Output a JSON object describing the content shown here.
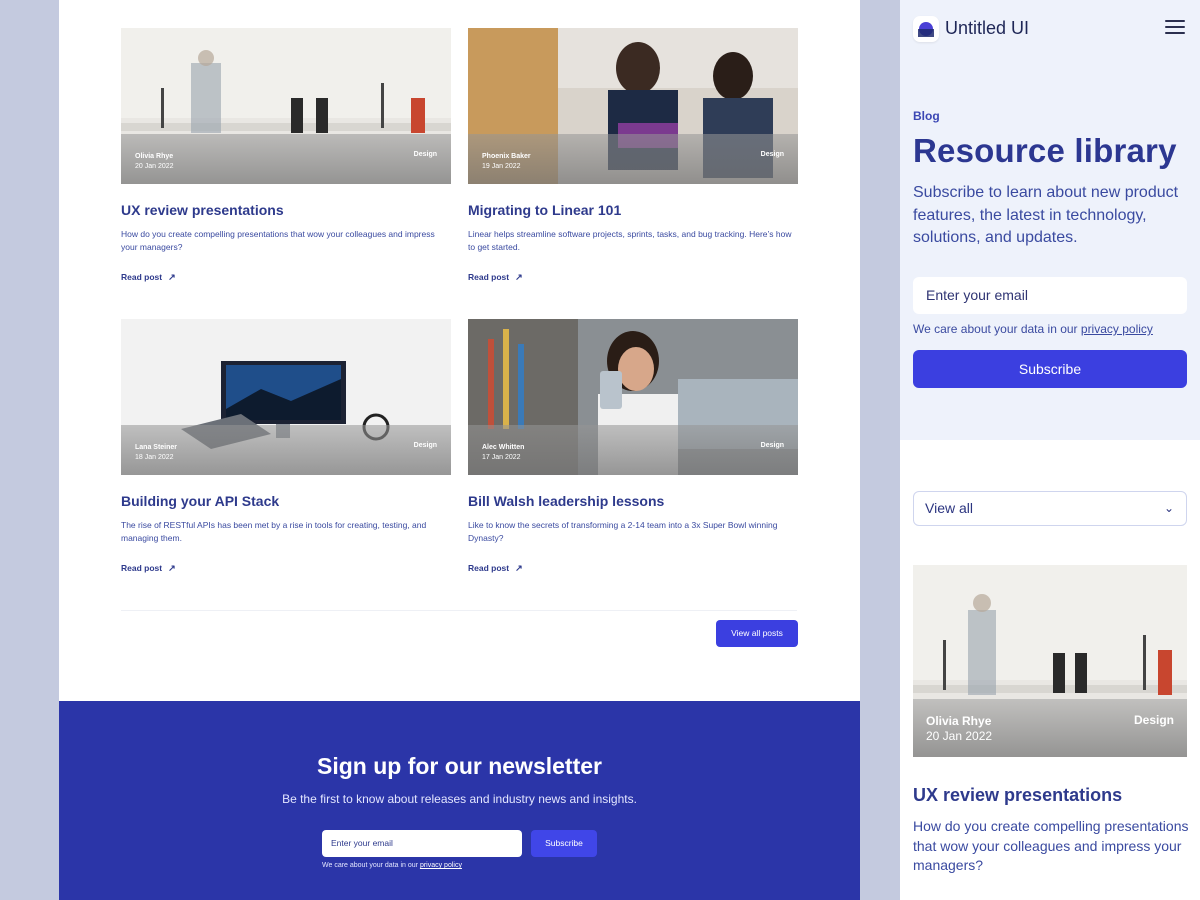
{
  "posts": [
    {
      "author": "Olivia Rhye",
      "date": "20 Jan 2022",
      "category": "Design",
      "title": "UX review presentations",
      "excerpt": "How do you create compelling presentations that wow your colleagues and impress your managers?",
      "read_label": "Read post",
      "arrow": "↗"
    },
    {
      "author": "Phoenix Baker",
      "date": "19 Jan 2022",
      "category": "Design",
      "title": "Migrating to Linear 101",
      "excerpt": "Linear helps streamline software projects, sprints, tasks, and bug tracking. Here’s how to get started.",
      "read_label": "Read post",
      "arrow": "↗"
    },
    {
      "author": "Lana Steiner",
      "date": "18 Jan 2022",
      "category": "Design",
      "title": "Building your API Stack",
      "excerpt": "The rise of RESTful APIs has been met by a rise in tools for creating, testing, and managing them.",
      "read_label": "Read post",
      "arrow": "↗"
    },
    {
      "author": "Alec Whitten",
      "date": "17 Jan 2022",
      "category": "Design",
      "title": "Bill Walsh leadership lessons",
      "excerpt": "Like to know the secrets of transforming a 2-14 team into a 3x Super Bowl winning Dynasty?",
      "read_label": "Read post",
      "arrow": "↗"
    }
  ],
  "view_all_posts_label": "View all posts",
  "newsletter": {
    "title": "Sign up for our newsletter",
    "subtitle": "Be the first to know about releases and industry news and insights.",
    "email_placeholder": "Enter your email",
    "subscribe_label": "Subscribe",
    "note_prefix": "We care about your data in our ",
    "note_link": "privacy policy"
  },
  "mobile": {
    "app_name": "Untitled UI",
    "eyebrow": "Blog",
    "title": "Resource library",
    "description": "Subscribe to learn about new product features, the latest in technology, solutions, and updates.",
    "email_placeholder": "Enter your email",
    "note_prefix": "We care about your data in our ",
    "note_link": "privacy policy",
    "subscribe_label": "Subscribe",
    "filter_value": "View all",
    "filter_chevron": "⌄",
    "card": {
      "author": "Olivia Rhye",
      "date": "20 Jan 2022",
      "category": "Design",
      "title": "UX review presentations",
      "excerpt": "How do you create compelling presentations that wow your colleagues and impress your managers?"
    }
  },
  "icons": {
    "logo": "logo-icon",
    "menu": "menu-icon",
    "arrow": "arrow-up-right-icon",
    "chevron": "chevron-down-icon"
  },
  "colors": {
    "brand": "#3b3fe0",
    "newsletter_bg": "#2b35a8",
    "text": "#2e3a8c",
    "canvas": "#c4cadf"
  }
}
